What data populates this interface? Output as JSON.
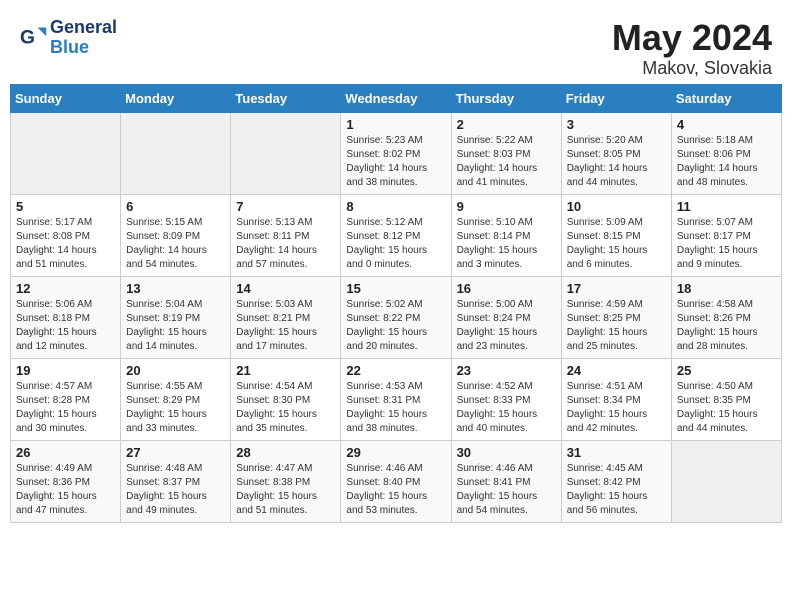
{
  "header": {
    "logo_general": "General",
    "logo_blue": "Blue",
    "month_year": "May 2024",
    "location": "Makov, Slovakia"
  },
  "days_of_week": [
    "Sunday",
    "Monday",
    "Tuesday",
    "Wednesday",
    "Thursday",
    "Friday",
    "Saturday"
  ],
  "weeks": [
    [
      {
        "day": "",
        "info": ""
      },
      {
        "day": "",
        "info": ""
      },
      {
        "day": "",
        "info": ""
      },
      {
        "day": "1",
        "info": "Sunrise: 5:23 AM\nSunset: 8:02 PM\nDaylight: 14 hours\nand 38 minutes."
      },
      {
        "day": "2",
        "info": "Sunrise: 5:22 AM\nSunset: 8:03 PM\nDaylight: 14 hours\nand 41 minutes."
      },
      {
        "day": "3",
        "info": "Sunrise: 5:20 AM\nSunset: 8:05 PM\nDaylight: 14 hours\nand 44 minutes."
      },
      {
        "day": "4",
        "info": "Sunrise: 5:18 AM\nSunset: 8:06 PM\nDaylight: 14 hours\nand 48 minutes."
      }
    ],
    [
      {
        "day": "5",
        "info": "Sunrise: 5:17 AM\nSunset: 8:08 PM\nDaylight: 14 hours\nand 51 minutes."
      },
      {
        "day": "6",
        "info": "Sunrise: 5:15 AM\nSunset: 8:09 PM\nDaylight: 14 hours\nand 54 minutes."
      },
      {
        "day": "7",
        "info": "Sunrise: 5:13 AM\nSunset: 8:11 PM\nDaylight: 14 hours\nand 57 minutes."
      },
      {
        "day": "8",
        "info": "Sunrise: 5:12 AM\nSunset: 8:12 PM\nDaylight: 15 hours\nand 0 minutes."
      },
      {
        "day": "9",
        "info": "Sunrise: 5:10 AM\nSunset: 8:14 PM\nDaylight: 15 hours\nand 3 minutes."
      },
      {
        "day": "10",
        "info": "Sunrise: 5:09 AM\nSunset: 8:15 PM\nDaylight: 15 hours\nand 6 minutes."
      },
      {
        "day": "11",
        "info": "Sunrise: 5:07 AM\nSunset: 8:17 PM\nDaylight: 15 hours\nand 9 minutes."
      }
    ],
    [
      {
        "day": "12",
        "info": "Sunrise: 5:06 AM\nSunset: 8:18 PM\nDaylight: 15 hours\nand 12 minutes."
      },
      {
        "day": "13",
        "info": "Sunrise: 5:04 AM\nSunset: 8:19 PM\nDaylight: 15 hours\nand 14 minutes."
      },
      {
        "day": "14",
        "info": "Sunrise: 5:03 AM\nSunset: 8:21 PM\nDaylight: 15 hours\nand 17 minutes."
      },
      {
        "day": "15",
        "info": "Sunrise: 5:02 AM\nSunset: 8:22 PM\nDaylight: 15 hours\nand 20 minutes."
      },
      {
        "day": "16",
        "info": "Sunrise: 5:00 AM\nSunset: 8:24 PM\nDaylight: 15 hours\nand 23 minutes."
      },
      {
        "day": "17",
        "info": "Sunrise: 4:59 AM\nSunset: 8:25 PM\nDaylight: 15 hours\nand 25 minutes."
      },
      {
        "day": "18",
        "info": "Sunrise: 4:58 AM\nSunset: 8:26 PM\nDaylight: 15 hours\nand 28 minutes."
      }
    ],
    [
      {
        "day": "19",
        "info": "Sunrise: 4:57 AM\nSunset: 8:28 PM\nDaylight: 15 hours\nand 30 minutes."
      },
      {
        "day": "20",
        "info": "Sunrise: 4:55 AM\nSunset: 8:29 PM\nDaylight: 15 hours\nand 33 minutes."
      },
      {
        "day": "21",
        "info": "Sunrise: 4:54 AM\nSunset: 8:30 PM\nDaylight: 15 hours\nand 35 minutes."
      },
      {
        "day": "22",
        "info": "Sunrise: 4:53 AM\nSunset: 8:31 PM\nDaylight: 15 hours\nand 38 minutes."
      },
      {
        "day": "23",
        "info": "Sunrise: 4:52 AM\nSunset: 8:33 PM\nDaylight: 15 hours\nand 40 minutes."
      },
      {
        "day": "24",
        "info": "Sunrise: 4:51 AM\nSunset: 8:34 PM\nDaylight: 15 hours\nand 42 minutes."
      },
      {
        "day": "25",
        "info": "Sunrise: 4:50 AM\nSunset: 8:35 PM\nDaylight: 15 hours\nand 44 minutes."
      }
    ],
    [
      {
        "day": "26",
        "info": "Sunrise: 4:49 AM\nSunset: 8:36 PM\nDaylight: 15 hours\nand 47 minutes."
      },
      {
        "day": "27",
        "info": "Sunrise: 4:48 AM\nSunset: 8:37 PM\nDaylight: 15 hours\nand 49 minutes."
      },
      {
        "day": "28",
        "info": "Sunrise: 4:47 AM\nSunset: 8:38 PM\nDaylight: 15 hours\nand 51 minutes."
      },
      {
        "day": "29",
        "info": "Sunrise: 4:46 AM\nSunset: 8:40 PM\nDaylight: 15 hours\nand 53 minutes."
      },
      {
        "day": "30",
        "info": "Sunrise: 4:46 AM\nSunset: 8:41 PM\nDaylight: 15 hours\nand 54 minutes."
      },
      {
        "day": "31",
        "info": "Sunrise: 4:45 AM\nSunset: 8:42 PM\nDaylight: 15 hours\nand 56 minutes."
      },
      {
        "day": "",
        "info": ""
      }
    ]
  ]
}
